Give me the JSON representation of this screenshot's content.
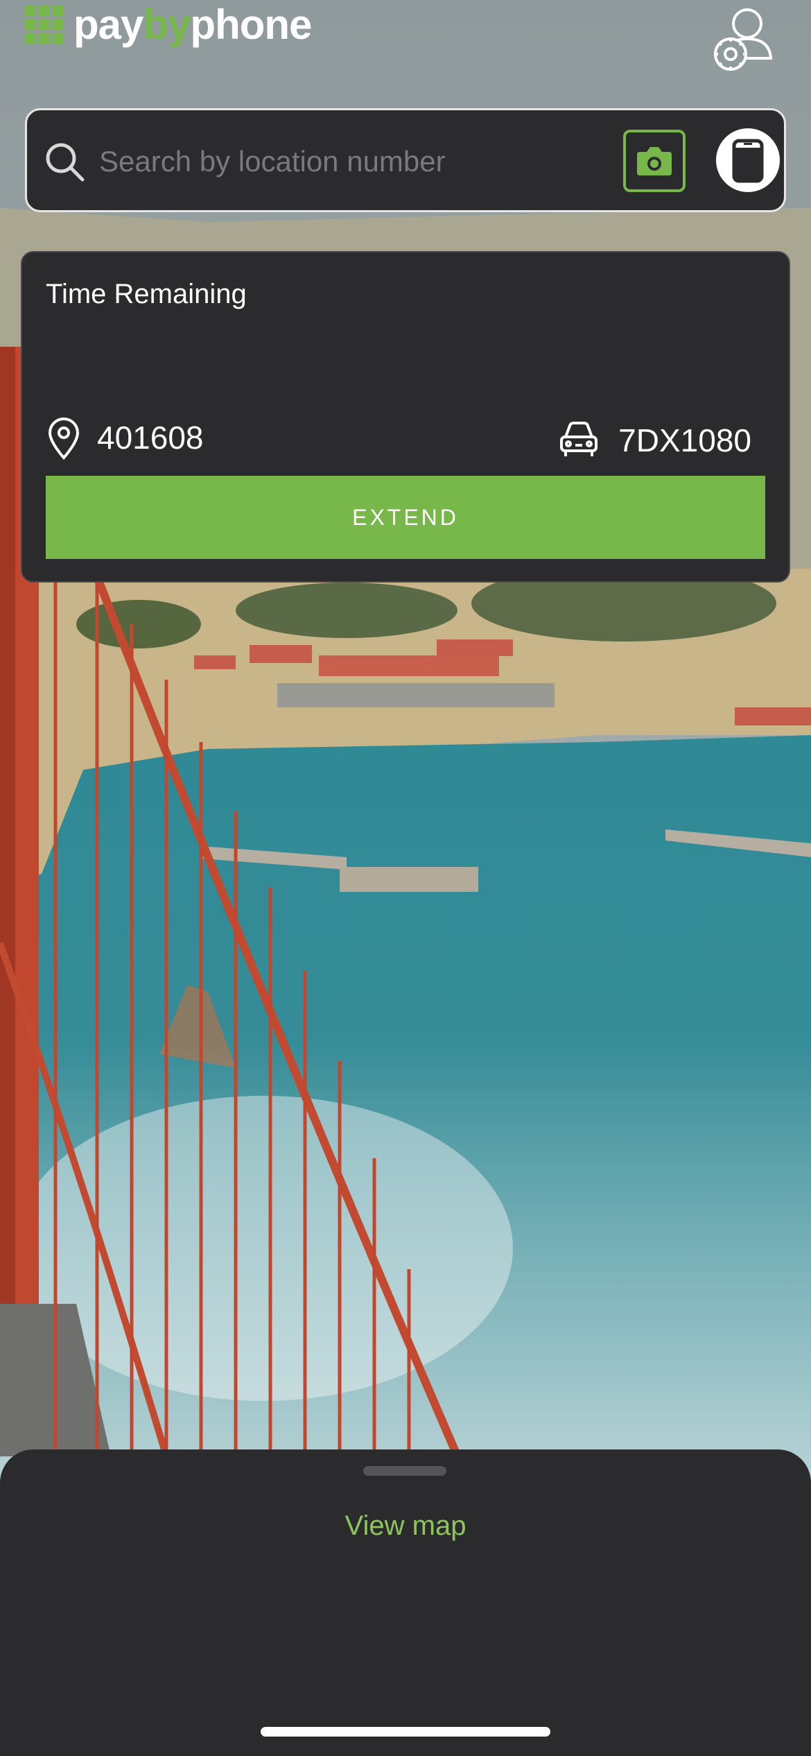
{
  "header": {
    "logo_text_pay": "pay",
    "logo_text_by": "by",
    "logo_text_phone": "phone",
    "account_icon": "account-settings-icon"
  },
  "search": {
    "placeholder": "Search by location number",
    "value": "",
    "search_icon": "search-icon",
    "camera_icon": "camera-icon",
    "phone_icon": "phone-icon"
  },
  "parking": {
    "time_remaining_label": "Time Remaining",
    "location_number": "401608",
    "license_plate": "7DX1080",
    "extend_label": "EXTEND"
  },
  "bottom_sheet": {
    "view_map_label": "View map"
  },
  "colors": {
    "brand_green": "#78b84a",
    "panel_bg": "#2b2b2d",
    "link_green": "#8ec460"
  }
}
